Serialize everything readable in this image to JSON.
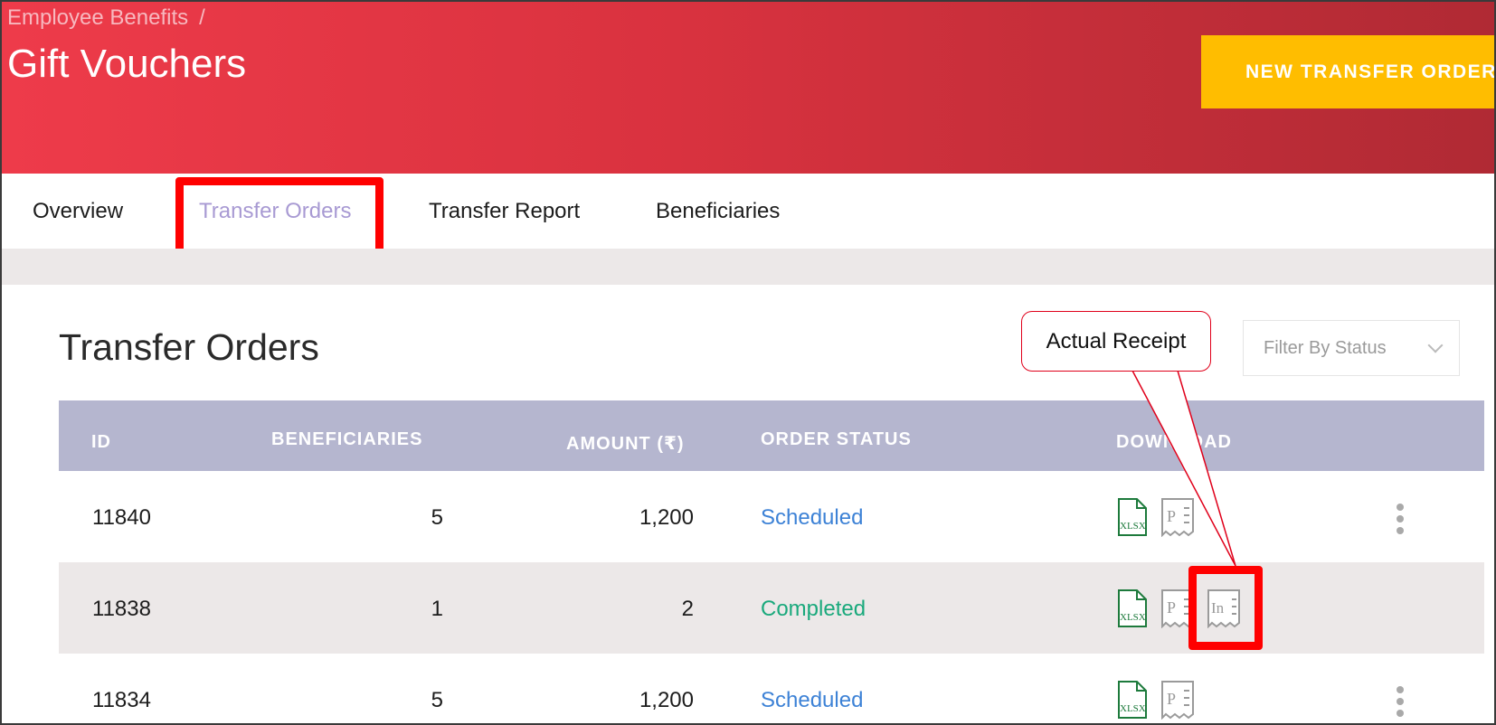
{
  "header": {
    "breadcrumb": "Employee Benefits",
    "breadcrumb_separator": "/",
    "title": "Gift Vouchers",
    "new_order_button": "NEW TRANSFER ORDER",
    "accent_color": "#ffbd00",
    "banner_color": "#d9323f"
  },
  "tabs": [
    {
      "label": "Overview",
      "active": false
    },
    {
      "label": "Transfer Orders",
      "active": true
    },
    {
      "label": "Transfer Report",
      "active": false
    },
    {
      "label": "Beneficiaries",
      "active": false
    }
  ],
  "section": {
    "title": "Transfer Orders",
    "filter_placeholder": "Filter By Status"
  },
  "table": {
    "headers": {
      "id": "ID",
      "beneficiaries": "BENEFICIARIES",
      "amount": "AMOUNT (₹)",
      "status": "ORDER STATUS",
      "download": "DOWNLOAD"
    },
    "rows": [
      {
        "id": "11840",
        "beneficiaries": "5",
        "amount": "1,200",
        "status": "Scheduled",
        "downloads": [
          "xlsx-icon",
          "pdf-receipt-icon"
        ]
      },
      {
        "id": "11838",
        "beneficiaries": "1",
        "amount": "2",
        "status": "Completed",
        "downloads": [
          "xlsx-icon",
          "pdf-receipt-icon",
          "invoice-receipt-icon"
        ]
      },
      {
        "id": "11834",
        "beneficiaries": "5",
        "amount": "1,200",
        "status": "Scheduled",
        "downloads": [
          "xlsx-icon",
          "pdf-receipt-icon"
        ]
      }
    ]
  },
  "icons": {
    "xlsx_text": "XLSX",
    "pdf_text": "P",
    "invoice_text": "In"
  },
  "annotation": {
    "callout_text": "Actual Receipt",
    "highlight_color": "#ff0000"
  }
}
